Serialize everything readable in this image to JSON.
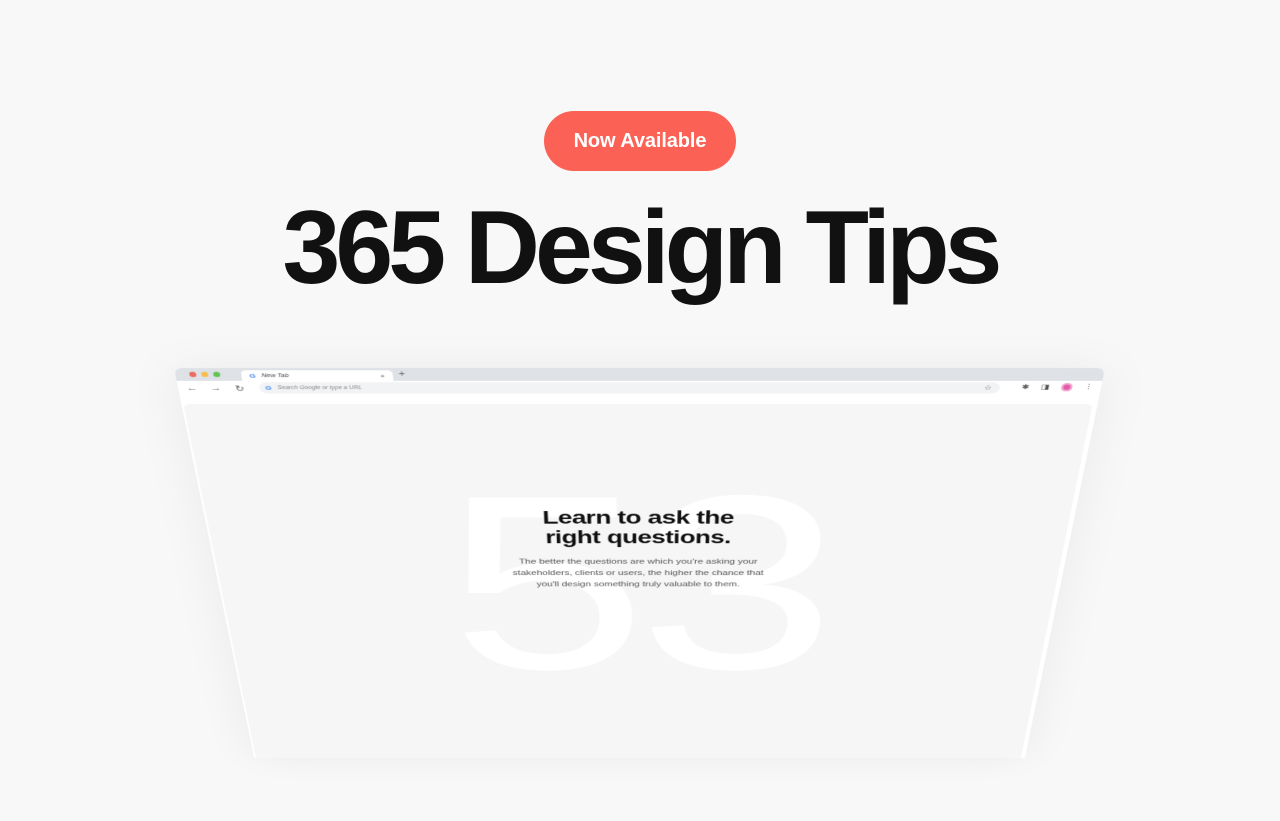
{
  "hero": {
    "badge_label": "Now Available",
    "headline": "365 Design Tips"
  },
  "browser": {
    "window_controls": [
      {
        "name": "close",
        "color": "#ed6a5e"
      },
      {
        "name": "minimize",
        "color": "#f5bf4f"
      },
      {
        "name": "maximize",
        "color": "#61c554"
      }
    ],
    "tab": {
      "favicon": "G",
      "title": "New Tab",
      "close_glyph": "×"
    },
    "new_tab_glyph": "+",
    "nav": {
      "back_glyph": "←",
      "forward_glyph": "→",
      "reload_glyph": "↻"
    },
    "omnibox": {
      "favicon": "G",
      "placeholder": "Search Google or type a URL",
      "bookmark_glyph": "☆"
    },
    "toolbar_icons": {
      "extensions_glyph": "✱",
      "sidepanel_glyph": "◨",
      "menu_glyph": "⋮"
    }
  },
  "tip": {
    "number": "53",
    "title_line1": "Learn to ask the",
    "title_line2": "right questions.",
    "body_line1": "The better the questions are which you're asking your",
    "body_line2": "stakeholders, clients or users, the higher the chance that",
    "body_line3": "you'll design something truly valuable to them."
  },
  "colors": {
    "accent": "#fb6154",
    "background": "#f8f8f8",
    "headline": "#111111"
  }
}
